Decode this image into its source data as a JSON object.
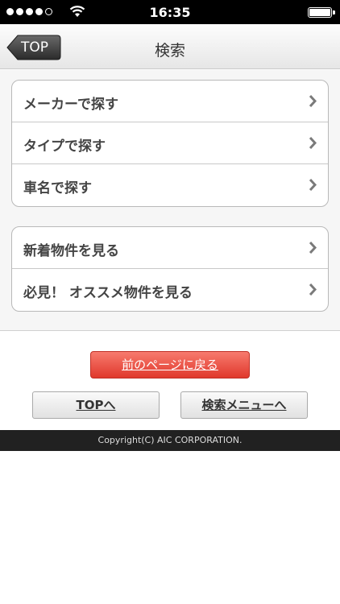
{
  "status_bar": {
    "time": "16:35",
    "signal_bars_filled": 4,
    "signal_bars_total": 5,
    "battery_level": 1.0
  },
  "nav": {
    "back_label": "TOP",
    "title": "検索"
  },
  "menu_groups": [
    {
      "items": [
        {
          "label": "メーカーで探す"
        },
        {
          "label": "タイプで探す"
        },
        {
          "label": "車名で探す"
        }
      ]
    },
    {
      "items": [
        {
          "label": "新着物件を見る"
        },
        {
          "label": "必見！ オススメ物件を見る"
        }
      ]
    }
  ],
  "buttons": {
    "prev_page": "前のページに戻る",
    "top": "TOPへ",
    "search_menu": "検索メニューへ"
  },
  "footer": {
    "copyright": "Copyright(C) AIC CORPORATION."
  },
  "colors": {
    "accent_red": "#e0392c",
    "footer_bg": "#212121"
  }
}
